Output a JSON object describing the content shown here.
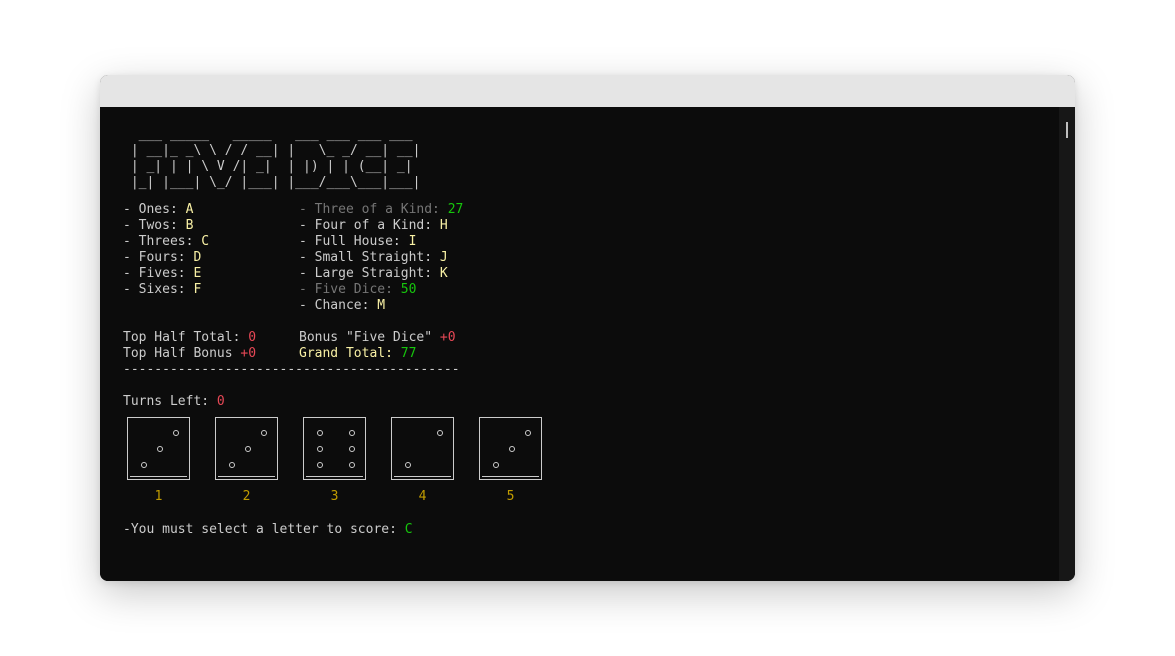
{
  "banner": {
    "lines": [
      "  ___ _____   _____   ___ ___ ___ ___ ",
      " | __|_ _\\ \\ / / __| |   \\_ _/ __| __|",
      " | _| | | \\ V /| _|  | |) | | (__| _| ",
      " |_| |___| \\_/ |___| |___/___\\___|___|"
    ]
  },
  "top_half": [
    {
      "label": "- Ones: ",
      "value": "A"
    },
    {
      "label": "- Twos: ",
      "value": "B"
    },
    {
      "label": "- Threes: ",
      "value": "C"
    },
    {
      "label": "- Fours: ",
      "value": "D"
    },
    {
      "label": "- Fives: ",
      "value": "E"
    },
    {
      "label": "- Sixes: ",
      "value": "F"
    }
  ],
  "bottom_half": [
    {
      "label": "- Three of a Kind: ",
      "value": "27"
    },
    {
      "label": "- Four of a Kind: ",
      "value": "H"
    },
    {
      "label": "- Full House: ",
      "value": "I"
    },
    {
      "label": "- Small Straight: ",
      "value": "J"
    },
    {
      "label": "- Large Straight: ",
      "value": "K"
    },
    {
      "label": "- Five Dice: ",
      "value": "50"
    },
    {
      "label": "- Chance: ",
      "value": "M"
    }
  ],
  "totals": {
    "top_half_total_label": "Top Half Total: ",
    "top_half_total_value": "0",
    "top_half_bonus_label": "Top Half Bonus ",
    "top_half_bonus_value": "+0",
    "bonus_five_dice_label": "Bonus \"Five Dice\" ",
    "bonus_five_dice_value": "+0",
    "grand_total_label": "Grand Total: ",
    "grand_total_value": "77"
  },
  "separator": "-------------------------------------------",
  "turns": {
    "label": "Turns Left: ",
    "value": "0"
  },
  "dice": [
    {
      "label": "1",
      "face": 3
    },
    {
      "label": "2",
      "face": 3
    },
    {
      "label": "3",
      "face": 6
    },
    {
      "label": "4",
      "face": 2
    },
    {
      "label": "5",
      "face": 3
    }
  ],
  "prompt": {
    "label": "-You must select a letter to score: ",
    "value": "C"
  },
  "colors": {
    "background": "#0c0c0c",
    "text": "#cccccc",
    "letter": "#f9f1a5",
    "score_green": "#16c60c",
    "score_red": "#e74856",
    "used_dim": "#767676",
    "die_label": "#c19c00"
  }
}
